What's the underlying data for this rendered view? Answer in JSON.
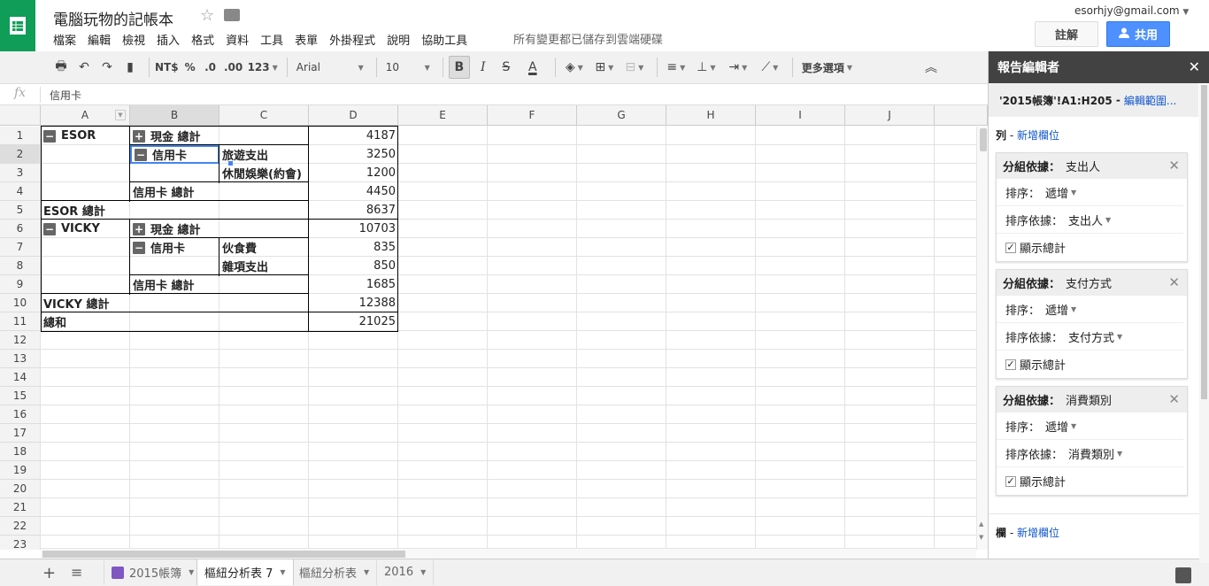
{
  "app": {
    "title": "電腦玩物的記帳本",
    "star_icon": "☆",
    "saved_status": "所有變更都已儲存到雲端硬碟",
    "account": "esorhjy@gmail.com",
    "understand_label": "註解",
    "share_label": "共用",
    "menu": [
      "檔案",
      "編輯",
      "檢視",
      "插入",
      "格式",
      "資料",
      "工具",
      "表單",
      "外掛程式",
      "說明",
      "協助工具"
    ]
  },
  "toolbar": {
    "currency": "NT$",
    "percent": "%",
    "dec_less": ".0",
    "dec_more": ".00",
    "more_formats": "123",
    "font": "Arial",
    "size": "10",
    "bold": "B",
    "italic": "I",
    "strike": "S",
    "textcolor": "A",
    "more": "更多選項"
  },
  "formula": {
    "fx": "fx",
    "value": "信用卡"
  },
  "columns": [
    "A",
    "B",
    "C",
    "D",
    "E",
    "F",
    "G",
    "H",
    "I",
    "J"
  ],
  "rows": [
    "1",
    "2",
    "3",
    "4",
    "5",
    "6",
    "7",
    "8",
    "9",
    "10",
    "11",
    "12",
    "13",
    "14",
    "15",
    "16",
    "17",
    "18",
    "19",
    "20",
    "21",
    "22",
    "23"
  ],
  "pivot": {
    "esor": "ESOR",
    "cash_total": "現金 總計",
    "credit": "信用卡",
    "travel": "旅遊支出",
    "leisure": "休閒娛樂(約會)",
    "credit_total": "信用卡 總計",
    "esor_total": "ESOR 總計",
    "vicky": "VICKY",
    "cash_total2": "現金 總計",
    "credit2": "信用卡",
    "food": "伙食費",
    "misc": "雜項支出",
    "credit_total2": "信用卡 總計",
    "vicky_total": "VICKY 總計",
    "grand_total": "總和",
    "v1": "4187",
    "v2": "3250",
    "v3": "1200",
    "v4": "4450",
    "v5": "8637",
    "v6": "10703",
    "v7": "835",
    "v8": "850",
    "v9": "1685",
    "v10": "12388",
    "v11": "21025"
  },
  "sheets": {
    "s1": "2015帳簿",
    "s2": "樞紐分析表 7",
    "s3": "樞紐分析表",
    "s4": "2016"
  },
  "panel": {
    "title": "報告編輯者",
    "range": "'2015帳簿'!A1:H205",
    "edit_range": "編輯範圍...",
    "rows_label": "列",
    "add_field": "新增欄位",
    "cols_label": "欄",
    "group_by": "分組依據：",
    "sort_label": "排序：",
    "sort_by_label": "排序依據：",
    "ascending": "遞增",
    "show_totals": "顯示總計",
    "groups": [
      {
        "field": "支出人",
        "sort": "遞增",
        "sort_by": "支出人"
      },
      {
        "field": "支付方式",
        "sort": "遞增",
        "sort_by": "支付方式"
      },
      {
        "field": "消費類別",
        "sort": "遞增",
        "sort_by": "消費類別"
      }
    ]
  }
}
